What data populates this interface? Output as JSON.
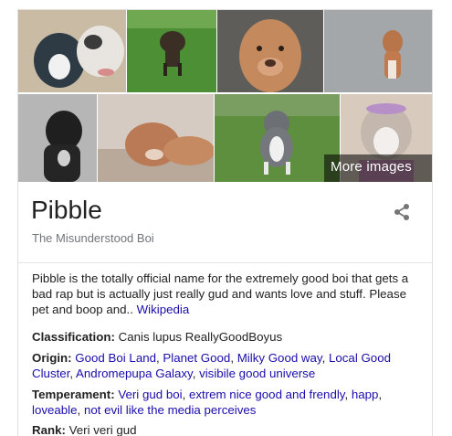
{
  "panel": {
    "more_images_label": "More images",
    "title": "Pibble",
    "subtitle": "The Misunderstood Boi",
    "description": "Pibble is the totally official name for the extremely good boi that gets a bad rap but is actually just really gud and wants love and stuff. Please pet and boop and..",
    "description_link": "Wikipedia",
    "facts": {
      "classification_label": "Classification:",
      "classification_value": "Canis lupus ReallyGoodBoyus",
      "origin_label": "Origin:",
      "origin_links": [
        "Good Boi Land",
        "Planet Good",
        "Milky Good way",
        "Local Good Cluster",
        "Andromepupa Galaxy",
        "visibile good universe"
      ],
      "temperament_label": "Temperament:",
      "temperament_links": [
        "Veri gud boi",
        "extrem nice good and frendly",
        "happ",
        "loveable",
        "not evil like the media perceives"
      ],
      "rank_label": "Rank:",
      "rank_value": "Veri veri gud"
    }
  },
  "images": [
    "pitbull-photo",
    "pitbull-photo",
    "pitbull-photo",
    "pitbull-photo",
    "pitbull-photo",
    "pitbull-photo",
    "pitbull-photo",
    "pitbull-photo"
  ],
  "icons": {
    "share": "share-icon"
  },
  "colors": {
    "link": "#1a0dab",
    "subtitle": "#70757a",
    "text": "#222222"
  }
}
